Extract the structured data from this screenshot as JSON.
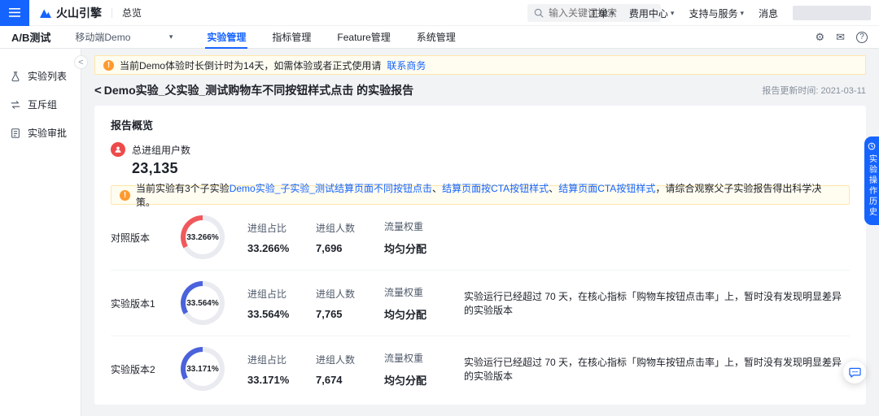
{
  "icons": {
    "caret": "▾",
    "back": "<",
    "collapse": "<",
    "gear": "⚙",
    "mail": "✉",
    "help": "?",
    "warning": "!"
  },
  "colors": {
    "accent": "#1664ff",
    "control_arc": "#f0595c",
    "variant_arc": "#4a62db",
    "track": "#e9ebf0",
    "warn": "#ff9a2e",
    "stat_circle": "#ee4a49"
  },
  "topbar": {
    "logo_text": "火山引擎",
    "overview": "总览",
    "search_placeholder": "输入关键词搜索",
    "menus": [
      {
        "label": "工单"
      },
      {
        "label": "费用中心"
      },
      {
        "label": "支持与服务"
      },
      {
        "label": "消息"
      }
    ]
  },
  "subnav": {
    "product": "A/B测试",
    "app": "移动端Demo",
    "tabs": [
      {
        "label": "实验管理"
      },
      {
        "label": "指标管理"
      },
      {
        "label": "Feature管理"
      },
      {
        "label": "系统管理"
      }
    ]
  },
  "sidebar": {
    "items": [
      {
        "label": "实验列表"
      },
      {
        "label": "互斥组"
      },
      {
        "label": "实验审批"
      }
    ]
  },
  "notice": {
    "text": "当前Demo体验时长倒计时为14天，如需体验或者正式使用请",
    "link": "联系商务"
  },
  "page": {
    "title": "Demo实验_父实验_测试购物车不同按钮样式点击 的实验报告",
    "report_time": "报告更新时间: 2021-03-11"
  },
  "overview": {
    "card_title": "报告概览",
    "total_label": "总进组用户数",
    "total_value": "23,135",
    "sub_notice": {
      "prefix": "当前实验有3个子实验",
      "link1": "Demo实验_子实验_测试结算页面不同按钮点击",
      "sep1": "、",
      "link2": "结算页面按CTA按钮样式",
      "sep2": "、",
      "link3": "结算页面CTA按钮样式",
      "suffix": "，请综合观察父子实验报告得出科学决策。"
    }
  },
  "versions": [
    {
      "label": "对照版本",
      "pct": 33.266,
      "pct_text": "33.266%",
      "ratio_label": "进组占比",
      "ratio_value": "33.266%",
      "users_label": "进组人数",
      "users_value": "7,696",
      "weight_label": "流量权重",
      "weight_value": "均匀分配",
      "desc": "",
      "color": "#f0595c"
    },
    {
      "label": "实验版本1",
      "pct": 33.564,
      "pct_text": "33.564%",
      "ratio_label": "进组占比",
      "ratio_value": "33.564%",
      "users_label": "进组人数",
      "users_value": "7,765",
      "weight_label": "流量权重",
      "weight_value": "均匀分配",
      "desc": "实验运行已经超过 70 天，在核心指标「购物车按钮点击率」上，暂时没有发现明显差异的实验版本",
      "color": "#4a62db"
    },
    {
      "label": "实验版本2",
      "pct": 33.171,
      "pct_text": "33.171%",
      "ratio_label": "进组占比",
      "ratio_value": "33.171%",
      "users_label": "进组人数",
      "users_value": "7,674",
      "weight_label": "流量权重",
      "weight_value": "均匀分配",
      "desc": "实验运行已经超过 70 天，在核心指标「购物车按钮点击率」上，暂时没有发现明显差异的实验版本",
      "color": "#4a62db"
    }
  ],
  "floaters": {
    "history": "实验操作历史"
  }
}
